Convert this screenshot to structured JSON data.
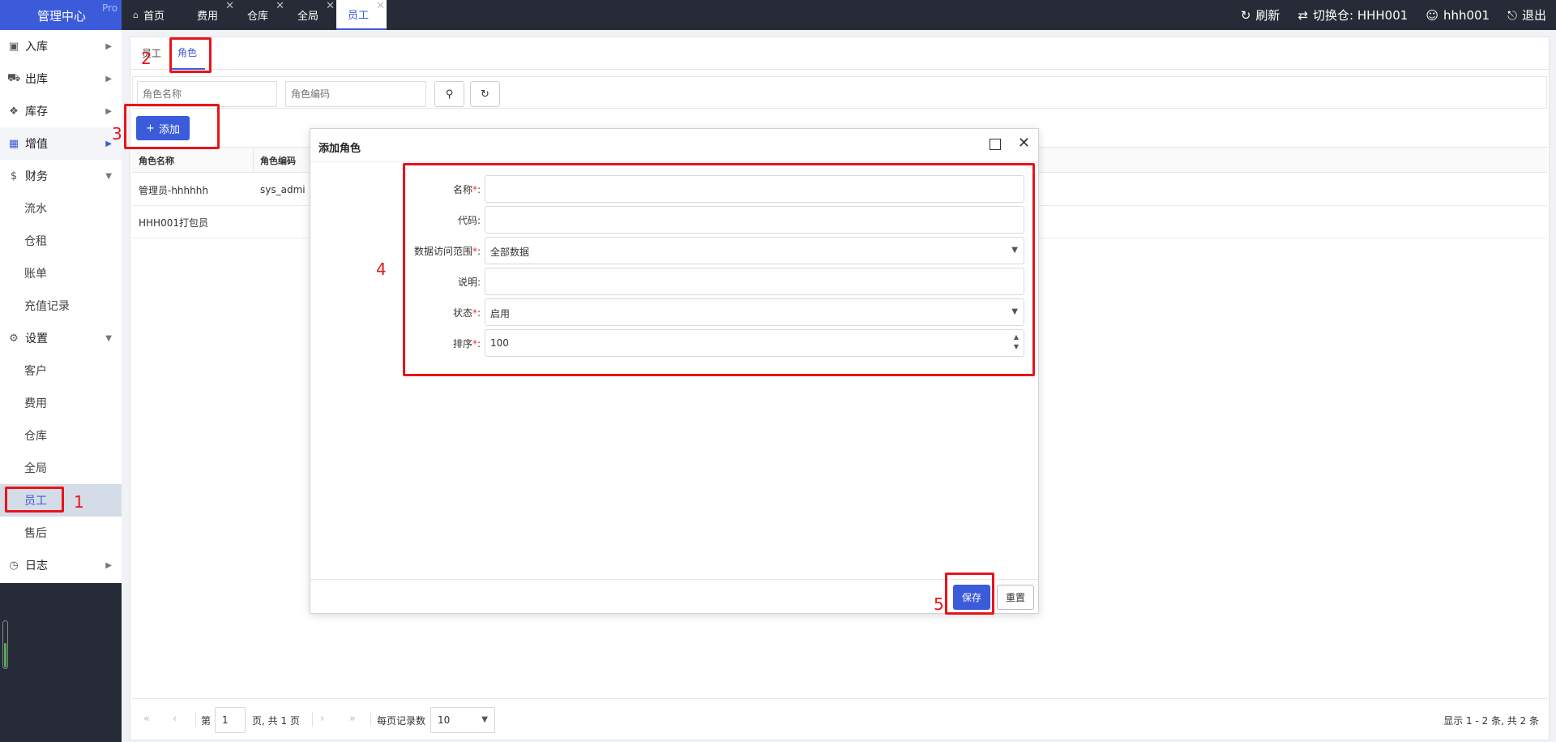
{
  "brand": {
    "title": "管理中心",
    "badge": "Pro"
  },
  "top_tabs": [
    {
      "label": "首页",
      "icon": "home-icon"
    },
    {
      "label": "费用",
      "close": "✕"
    },
    {
      "label": "仓库",
      "close": "✕"
    },
    {
      "label": "全局",
      "close": "✕"
    },
    {
      "label": "员工",
      "close": "✕"
    }
  ],
  "top_actions": {
    "refresh": "刷新",
    "switch_warehouse": "切换仓: HHH001",
    "user": "hhh001",
    "logout": "退出"
  },
  "sidebar": {
    "items": [
      {
        "label": "入库",
        "icon": "inbox-icon"
      },
      {
        "label": "出库",
        "icon": "truck-icon"
      },
      {
        "label": "库存",
        "icon": "boxes-icon"
      },
      {
        "label": "增值",
        "icon": "grid-icon"
      },
      {
        "label": "财务",
        "icon": "dollar-icon"
      },
      {
        "label": "流水"
      },
      {
        "label": "仓租"
      },
      {
        "label": "账单"
      },
      {
        "label": "充值记录"
      },
      {
        "label": "设置",
        "icon": "gears-icon"
      },
      {
        "label": "客户"
      },
      {
        "label": "费用"
      },
      {
        "label": "仓库"
      },
      {
        "label": "全局"
      },
      {
        "label": "员工"
      },
      {
        "label": "售后"
      },
      {
        "label": "日志",
        "icon": "clock-icon"
      }
    ]
  },
  "subtabs": [
    "员工",
    "角色"
  ],
  "filter": {
    "role_name_placeholder": "角色名称",
    "role_code_placeholder": "角色编码"
  },
  "add_button": "添加",
  "table": {
    "columns": [
      "角色名称",
      "角色编码"
    ],
    "rows": [
      [
        "管理员-hhhhhh",
        "sys_admi"
      ],
      [
        "HHH001打包员",
        ""
      ]
    ]
  },
  "pager": {
    "page_prefix": "第",
    "page_value": "1",
    "page_suffix": "页, 共 1 页",
    "per_page_label": "每页记录数",
    "per_page_value": "10",
    "summary": "显示 1 - 2 条, 共 2 条"
  },
  "modal": {
    "title": "添加角色",
    "fields": [
      {
        "label": "名称",
        "required": "*",
        "value": ""
      },
      {
        "label": "代码",
        "value": ""
      },
      {
        "label": "数据访问范围",
        "required": "*",
        "value": "全部数据"
      },
      {
        "label": "说明",
        "value": ""
      },
      {
        "label": "状态",
        "required": "*",
        "value": "启用"
      },
      {
        "label": "排序",
        "required": "*",
        "value": "100"
      }
    ],
    "save": "保存",
    "reset": "重置"
  },
  "annotations": [
    "1",
    "2",
    "3",
    "4",
    "5"
  ],
  "colors": {
    "accent": "#3b5bdb",
    "topbar": "#262b37",
    "annotation": "#e8141b"
  }
}
